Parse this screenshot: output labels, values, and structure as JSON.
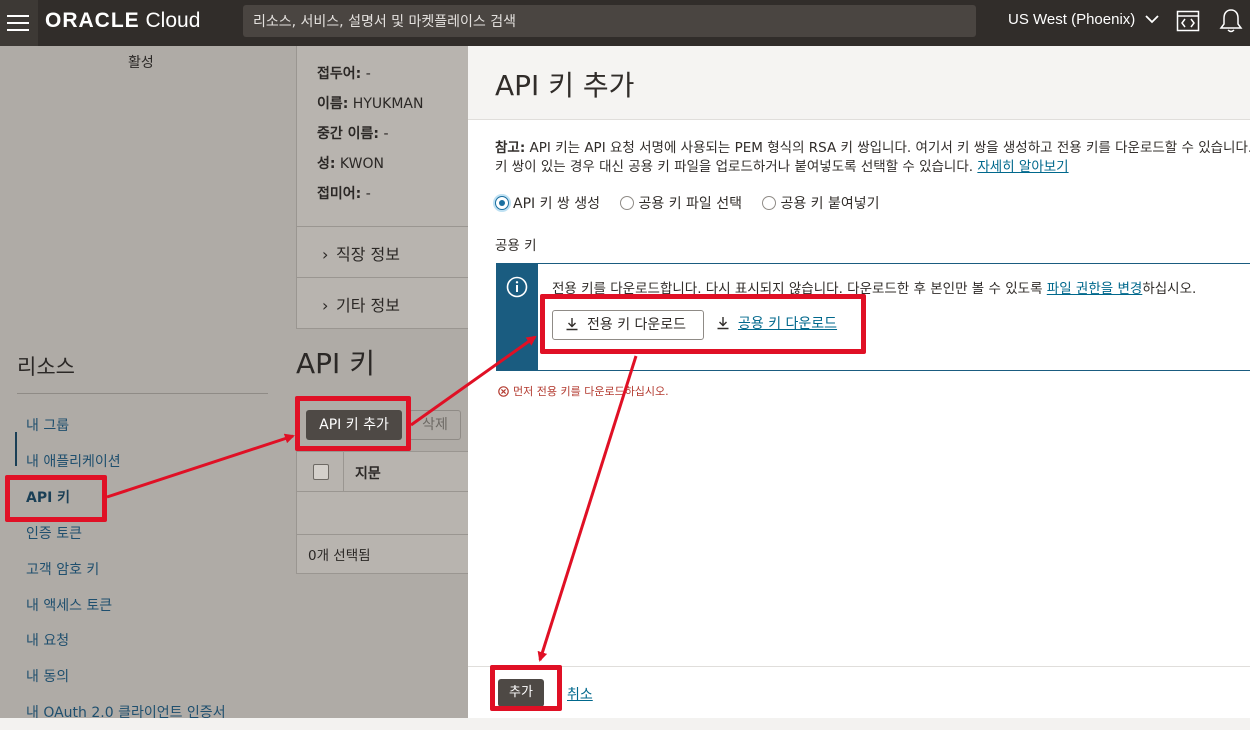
{
  "topbar": {
    "logo_brand": "ORACLE",
    "logo_suffix": "Cloud",
    "search_placeholder": "리소스, 서비스, 설명서 및 마켓플레이스 검색",
    "region": "US West (Phoenix)"
  },
  "background": {
    "status": "활성",
    "user_info": [
      {
        "label": "접두어:",
        "value": " -"
      },
      {
        "label": "이름:",
        "value": " HYUKMAN"
      },
      {
        "label": "중간 이름:",
        "value": " -"
      },
      {
        "label": "성:",
        "value": " KWON"
      },
      {
        "label": "접미어:",
        "value": " -"
      }
    ],
    "sections": [
      "직장 정보",
      "기타 정보"
    ],
    "resources_title": "리소스",
    "nav_items": [
      "내 그룹",
      "내 애플리케이션",
      "API 키",
      "인증 토큰",
      "고객 암호 키",
      "내 액세스 토큰",
      "내 요청",
      "내 동의",
      "내 OAuth 2.0 클라이언트 인증서"
    ],
    "active_nav": "API 키",
    "api_keys_title": "API 키",
    "add_button": "API 키 추가",
    "delete_button": "삭제",
    "table_header": "지문",
    "selected_count": "0개 선택됨"
  },
  "panel": {
    "title": "API 키 추가",
    "note_label": "참고:",
    "note_text": " API 키는 API 요청 서명에 사용되는 PEM 형식의 RSA 키 쌍입니다. 여기서 키 쌍을 생성하고 전용 키를 다운로드할 수 있습니다. 이미 키 쌍이 있는 경우 대신 공용 키 파일을 업로드하거나 붙여넣도록 선택할 수 있습니다. ",
    "note_link": "자세히 알아보기",
    "radio_options": [
      {
        "label": "API 키 쌍 생성",
        "selected": true
      },
      {
        "label": "공용 키 파일 선택",
        "selected": false
      },
      {
        "label": "공용 키 붙여넣기",
        "selected": false
      }
    ],
    "public_key_label": "공용 키",
    "notice_text_before": "전용 키를 다운로드합니다. 다시 표시되지 않습니다. 다운로드한 후 본인만 볼 수 있도록 ",
    "notice_link": "파일 권한을 변경",
    "notice_text_after": "하십시오.",
    "download_private": "전용 키 다운로드",
    "download_public": "공용 키 다운로드",
    "error_text": "먼저 전용 키를 다운로드하십시오.",
    "submit_button": "추가",
    "cancel_button": "취소"
  },
  "colors": {
    "topbar": "#312d2a",
    "annotation": "#e01025",
    "link": "#00688c",
    "notice_accent": "#1a5c80"
  }
}
